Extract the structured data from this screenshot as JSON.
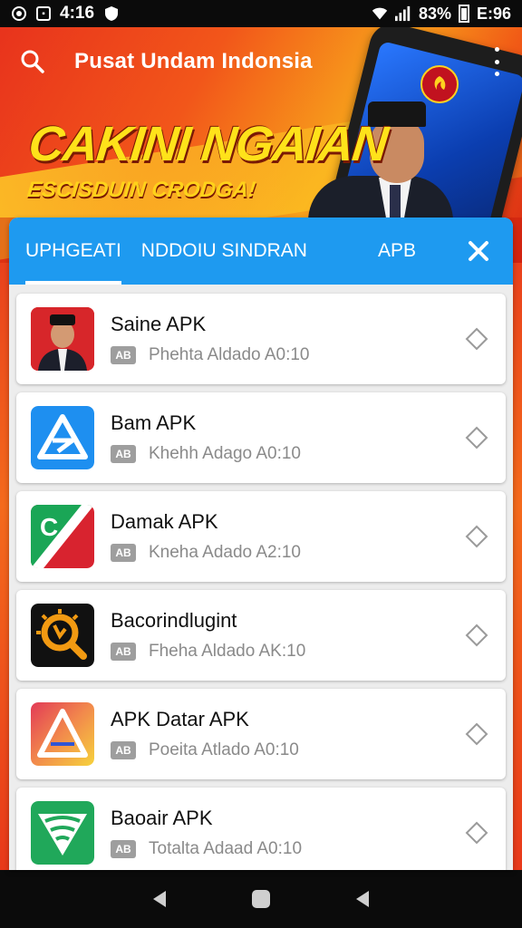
{
  "status_bar": {
    "time": "4:16",
    "battery_percent": "83%",
    "right_time": "E:96"
  },
  "header": {
    "title": "Pusat Undam Indonsia"
  },
  "hero": {
    "headline": "CAKINI NGAIAN",
    "subline": "ESCISDUIN CRODGA!"
  },
  "tabs": [
    {
      "label": "UPHGEATI",
      "active": true
    },
    {
      "label": "NDDOIU SINDRAN",
      "active": false
    },
    {
      "label": "APB",
      "active": false
    }
  ],
  "list": [
    {
      "title": "Saine APK",
      "badge": "AB",
      "meta": "Phehta Aldado A0:10",
      "icon": "portrait-icon"
    },
    {
      "title": "Bam APK",
      "badge": "AB",
      "meta": "Khehh Adago A0:10",
      "icon": "triangle-logo-icon"
    },
    {
      "title": "Damak APK",
      "badge": "AB",
      "meta": "Kneha Adado A2:10",
      "icon": "c-logo-icon"
    },
    {
      "title": "Bacorindlugint",
      "badge": "AB",
      "meta": "Fheha Aldado AK:10",
      "icon": "search-badge-icon"
    },
    {
      "title": "APK  Datar APK",
      "badge": "AB",
      "meta": "Poeita Atlado A0:10",
      "icon": "prism-logo-icon"
    },
    {
      "title": "Baoair APK",
      "badge": "AB",
      "meta": "Totalta Adaad A0:10",
      "icon": "shield-wifi-icon"
    }
  ],
  "colors": {
    "accent_blue": "#1e9af0",
    "header_orange": "#f2561a",
    "headline_yellow": "#ffe21a"
  }
}
